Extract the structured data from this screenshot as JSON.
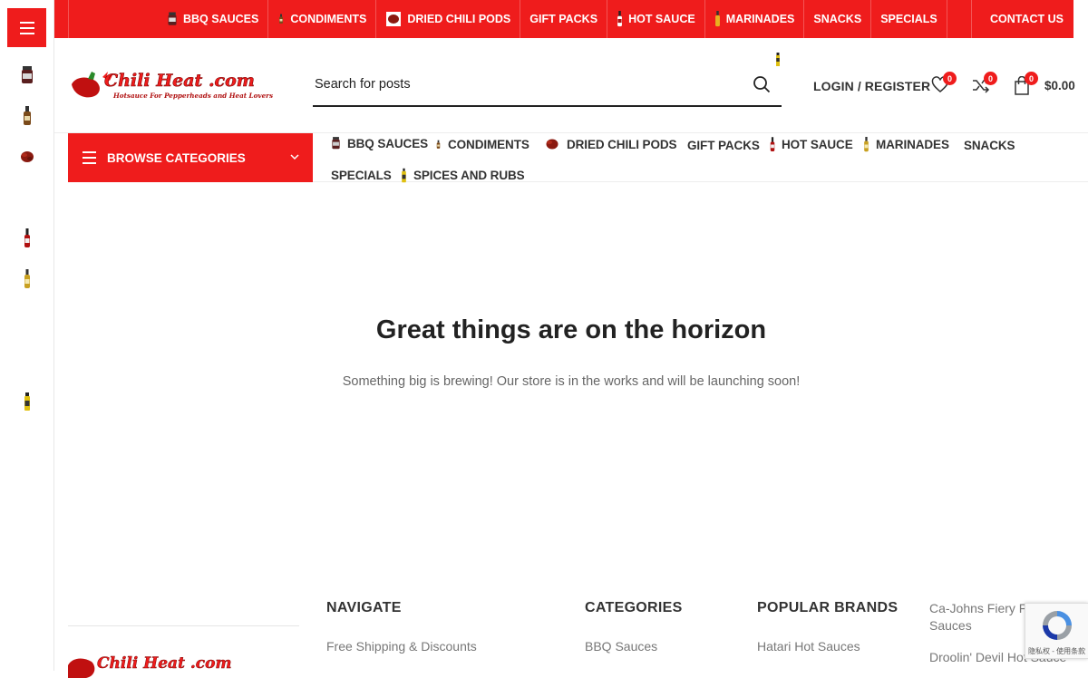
{
  "topnav": {
    "items": [
      {
        "label": "BBQ SAUCES",
        "icon": "bbq-jar-icon"
      },
      {
        "label": "CONDIMENTS",
        "icon": "condiment-bottle-icon"
      },
      {
        "label": "DRIED CHILI PODS",
        "icon": "chili-pods-icon"
      },
      {
        "label": "GIFT PACKS",
        "icon": ""
      },
      {
        "label": "HOT SAUCE",
        "icon": "hot-sauce-bottle-icon"
      },
      {
        "label": "MARINADES",
        "icon": "marinade-bottle-icon"
      },
      {
        "label": "SNACKS",
        "icon": ""
      },
      {
        "label": "SPECIALS",
        "icon": ""
      }
    ],
    "contact": "CONTACT US"
  },
  "header": {
    "logo_text": "Chili Heat .com",
    "logo_tagline": "Hotsauce For Pepperheads and Heat Lovers",
    "search_placeholder": "Search for posts",
    "login_label": "LOGIN / REGISTER",
    "wishlist_count": "0",
    "compare_count": "0",
    "cart_count": "0",
    "cart_total": "$0.00"
  },
  "browse": {
    "label": "BROWSE CATEGORIES"
  },
  "catnav": {
    "items": [
      {
        "label": "BBQ SAUCES"
      },
      {
        "label": "CONDIMENTS"
      },
      {
        "label": "DRIED CHILI PODS"
      },
      {
        "label": "GIFT PACKS"
      },
      {
        "label": "HOT SAUCE"
      },
      {
        "label": "MARINADES"
      },
      {
        "label": "SNACKS"
      },
      {
        "label": "SPECIALS"
      },
      {
        "label": "SPICES AND RUBS"
      }
    ]
  },
  "hero": {
    "title": "Great things are on the horizon",
    "subtitle": "Something big is brewing! Our store is in the works and will be launching soon!"
  },
  "footer": {
    "navigate": {
      "heading": "NAVIGATE",
      "links": [
        "Free Shipping & Discounts"
      ]
    },
    "categories": {
      "heading": "CATEGORIES",
      "links": [
        "BBQ Sauces"
      ]
    },
    "brands": {
      "heading": "POPULAR BRANDS",
      "links": [
        "Hatari Hot Sauces"
      ]
    },
    "brands2": {
      "links": [
        "Ca-Johns Fiery Fo",
        "Sauces",
        "Droolin' Devil Hot Sauce"
      ]
    }
  },
  "recaptcha": {
    "text": "隐私权 - 使用条款"
  },
  "colors": {
    "brand_red": "#ef1c1c",
    "text_dark": "#222222",
    "text_muted": "#777777"
  }
}
